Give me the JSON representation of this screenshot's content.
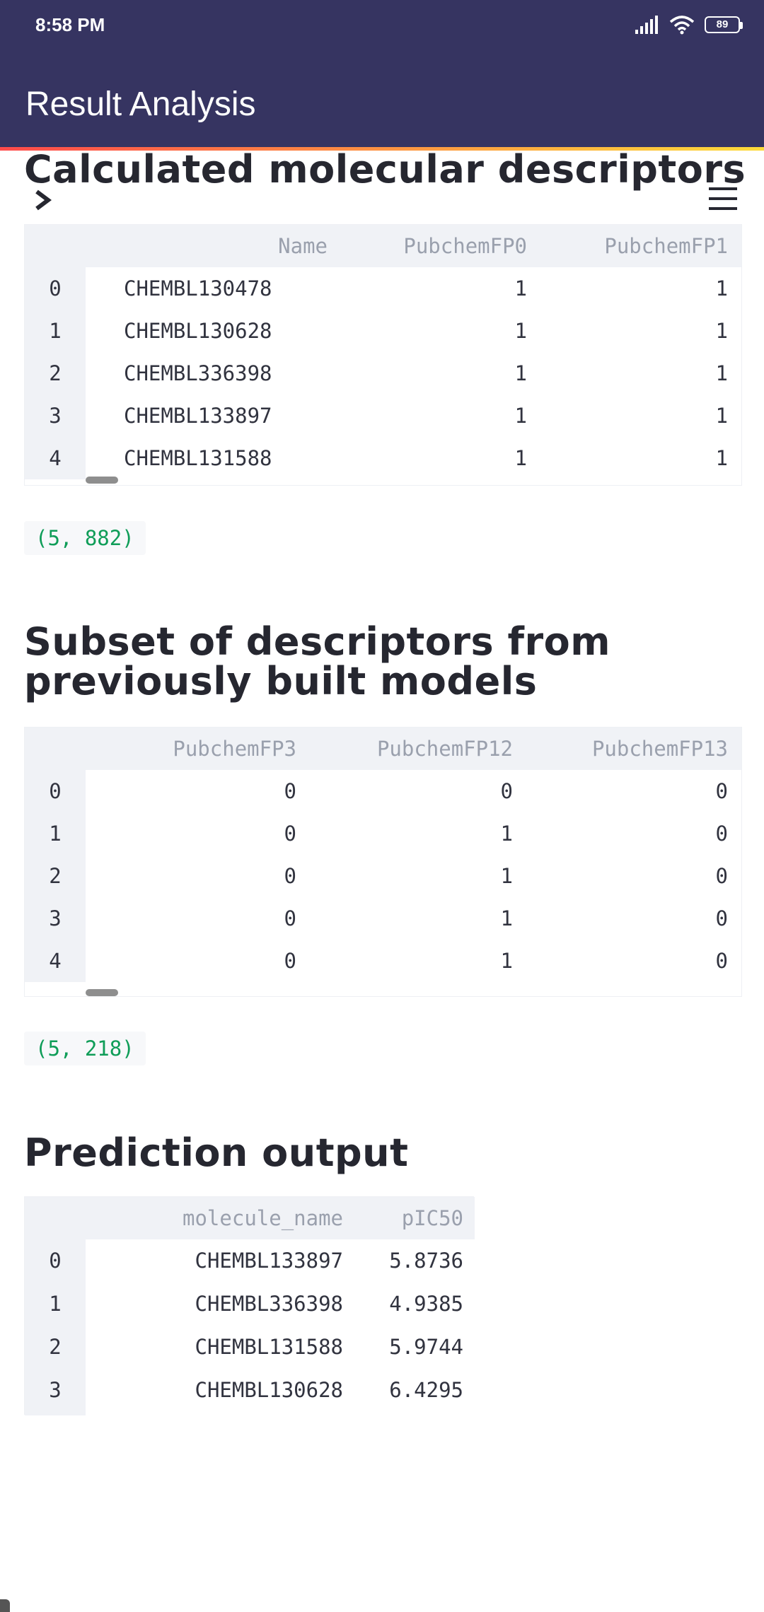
{
  "status_bar": {
    "time": "8:58 PM",
    "battery": "89",
    "icons": [
      "signal-icon",
      "wifi-icon",
      "battery-icon"
    ]
  },
  "app_bar": {
    "title": "Result Analysis"
  },
  "colors": {
    "app_bar_bg": "#363461",
    "accent_start": "#ff4b4b",
    "accent_end": "#fddb3a",
    "shape_text": "#0f9d58",
    "table_header_bg": "#f0f2f6"
  },
  "sections": {
    "calculated": {
      "heading": "Calculated molecular descriptors",
      "table": {
        "columns": [
          "",
          "Name",
          "PubchemFP0",
          "PubchemFP1"
        ],
        "rows": [
          [
            "0",
            "CHEMBL130478",
            "1",
            "1"
          ],
          [
            "1",
            "CHEMBL130628",
            "1",
            "1"
          ],
          [
            "2",
            "CHEMBL336398",
            "1",
            "1"
          ],
          [
            "3",
            "CHEMBL133897",
            "1",
            "1"
          ],
          [
            "4",
            "CHEMBL131588",
            "1",
            "1"
          ]
        ]
      },
      "shape": "(5, 882)"
    },
    "subset": {
      "heading": "Subset of descriptors from previously built models",
      "table": {
        "columns": [
          "",
          "PubchemFP3",
          "PubchemFP12",
          "PubchemFP13"
        ],
        "rows": [
          [
            "0",
            "0",
            "0",
            "0"
          ],
          [
            "1",
            "0",
            "1",
            "0"
          ],
          [
            "2",
            "0",
            "1",
            "0"
          ],
          [
            "3",
            "0",
            "1",
            "0"
          ],
          [
            "4",
            "0",
            "1",
            "0"
          ]
        ]
      },
      "shape": "(5, 218)"
    },
    "prediction": {
      "heading": "Prediction output",
      "table": {
        "columns": [
          "",
          "molecule_name",
          "pIC50"
        ],
        "rows": [
          [
            "0",
            "CHEMBL133897",
            "5.8736"
          ],
          [
            "1",
            "CHEMBL336398",
            "4.9385"
          ],
          [
            "2",
            "CHEMBL131588",
            "5.9744"
          ],
          [
            "3",
            "CHEMBL130628",
            "6.4295"
          ]
        ]
      }
    }
  }
}
